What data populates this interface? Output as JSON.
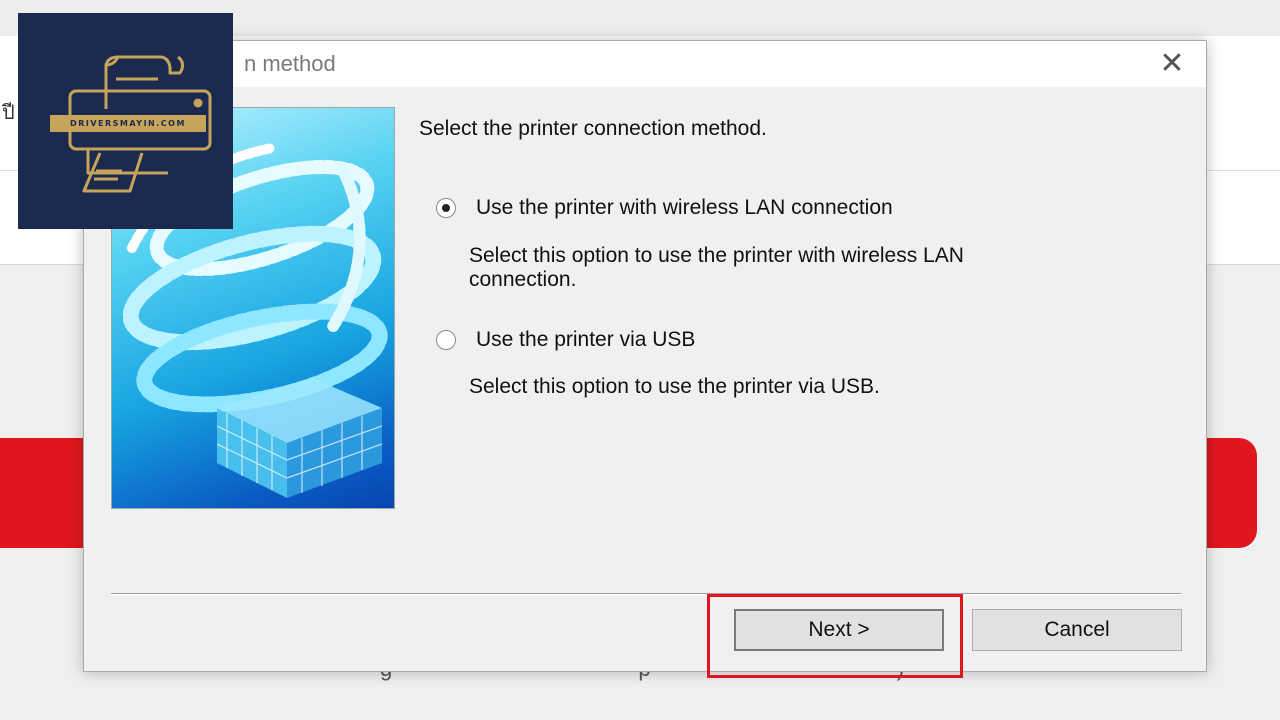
{
  "background": {
    "glyph": "ปี"
  },
  "dialog": {
    "title": "n method",
    "close_icon": "close-icon",
    "intro": "Select the printer connection method.",
    "options": [
      {
        "label": "Use the printer with wireless LAN connection",
        "description_line1": "Select this option to use the printer with wireless LAN",
        "description_line2": "connection.",
        "selected": true
      },
      {
        "label": "Use the printer via USB",
        "description_line1": "Select this option to use the printer via USB.",
        "selected": false
      }
    ],
    "buttons": {
      "next": "Next >",
      "cancel": "Cancel"
    }
  },
  "watermark": {
    "text": "DRIVERSMAYIN.COM"
  },
  "colors": {
    "highlight": "#e0161e",
    "logo_bg": "#1b2a4e",
    "logo_gold": "#c6a55a"
  }
}
